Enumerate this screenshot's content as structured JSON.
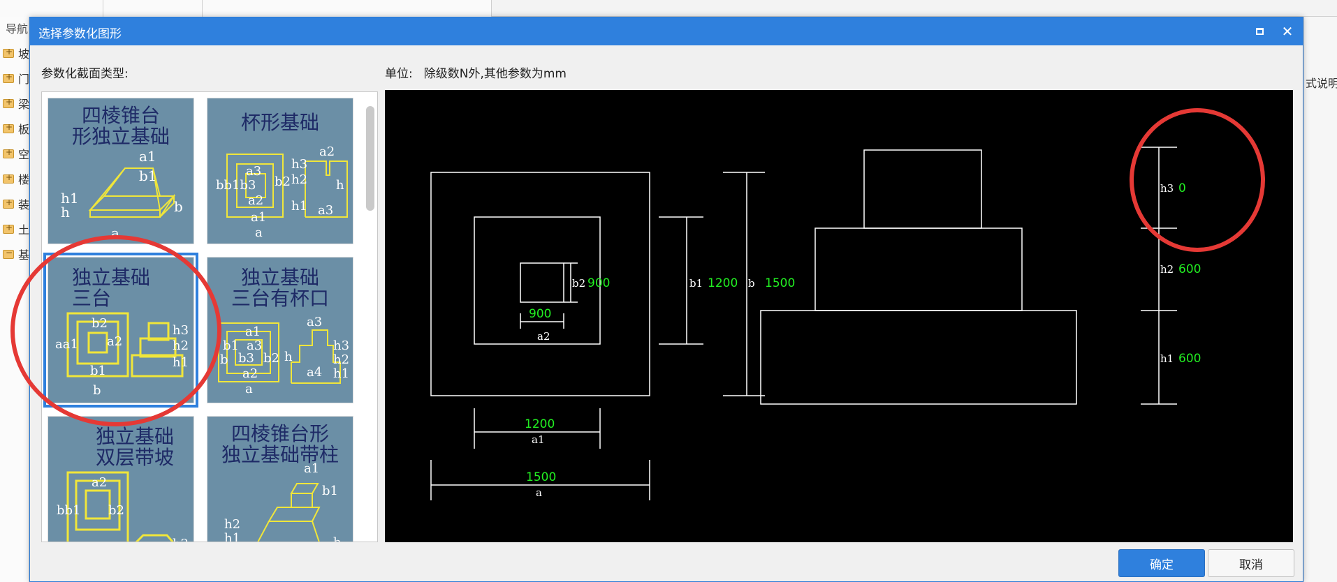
{
  "background": {
    "nav_title": "导航",
    "nav_items": [
      "坡",
      "门",
      "梁",
      "板",
      "空",
      "楼",
      "装",
      "土",
      "基"
    ],
    "right_text": "式说明"
  },
  "dialog": {
    "title": "选择参数化图形",
    "section_type_label": "参数化截面类型:",
    "unit_label": "单位:",
    "unit_text": "除级数N外,其他参数为mm",
    "thumbnails": [
      {
        "caption": "四棱锥台\n形独立基础"
      },
      {
        "caption": "杯形基础"
      },
      {
        "caption": "独立基础\n三台",
        "selected": true
      },
      {
        "caption": "独立基础\n三台有杯口"
      },
      {
        "caption": "独立基础\n双层带坡"
      },
      {
        "caption": "四棱锥台形\n独立基础带柱"
      }
    ],
    "ok_label": "确定",
    "cancel_label": "取消"
  },
  "drawing": {
    "params": {
      "a1": "1200",
      "a": "1500",
      "a2": "900",
      "b2": "900",
      "b1": "1200",
      "b": "1500",
      "h3": "0",
      "h2": "600",
      "h1": "600"
    },
    "labels": {
      "a1": "a1",
      "a": "a",
      "a2": "a2",
      "b2": "b2",
      "b1": "b1",
      "b": "b",
      "h3": "h3",
      "h2": "h2",
      "h1": "h1"
    }
  },
  "colors": {
    "accent": "#2f80dd",
    "annotation_red": "#e53935",
    "dim_value_green": "#22ee22",
    "thumb_bg": "#6b8fa6",
    "thumb_line": "#f0e63a"
  }
}
